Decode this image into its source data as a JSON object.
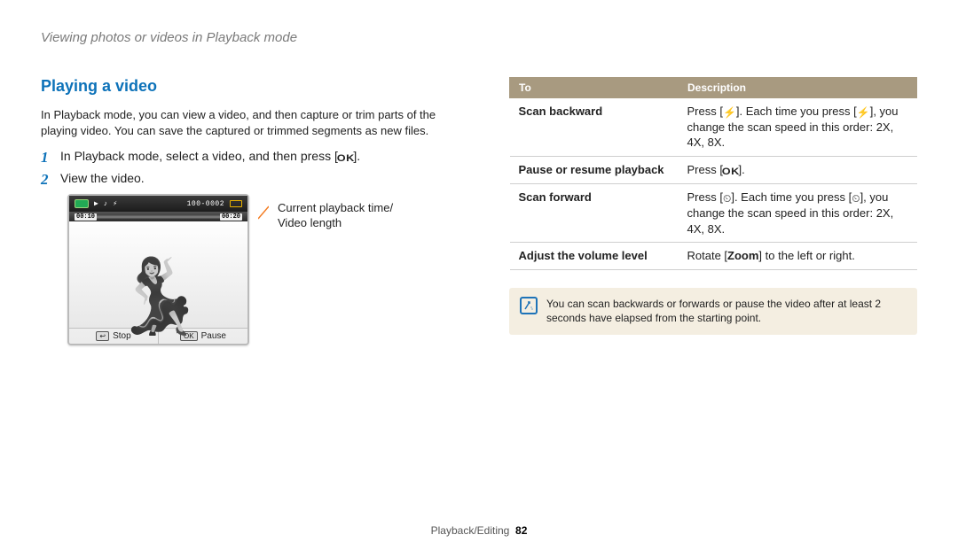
{
  "top_heading": "Viewing photos or videos in Playback mode",
  "section_title": "Playing a video",
  "intro": "In Playback mode, you can view a video, and then capture or trim parts of the playing video. You can save the captured or trimmed segments as new files.",
  "steps": {
    "s1_pre": "In Playback mode, select a video, and then press [",
    "s1_post": "].",
    "s2": "View the video."
  },
  "icons": {
    "ok": "OK",
    "bolt": "⚡",
    "timer": "⏲"
  },
  "figure": {
    "time_cur": "00:10",
    "time_len": "00:20",
    "counter": "100-0002",
    "stop_label": "Stop",
    "pause_label": "Pause",
    "back_key": "↩"
  },
  "callout_l1": "Current playback time/",
  "callout_l2": "Video length",
  "table": {
    "h_to": "To",
    "h_desc": "Description",
    "r1_to": "Scan backward",
    "r1_d_a": "Press [",
    "r1_d_b": "]. Each time you press [",
    "r1_d_c": "], you change the scan speed in this order: 2X, 4X, 8X.",
    "r2_to": "Pause or resume playback",
    "r2_d_a": "Press [",
    "r2_d_b": "].",
    "r3_to": "Scan forward",
    "r3_d_a": "Press [",
    "r3_d_b": "]. Each time you press [",
    "r3_d_c": "], you change the scan speed in this order: 2X, 4X, 8X.",
    "r4_to": "Adjust the volume level",
    "r4_d_a": "Rotate [",
    "r4_d_bold": "Zoom",
    "r4_d_b": "] to the left or right."
  },
  "note": "You can scan backwards or forwards or pause the video after at least 2 seconds have elapsed from the starting point.",
  "footer_section": "Playback/Editing",
  "footer_page": "82"
}
